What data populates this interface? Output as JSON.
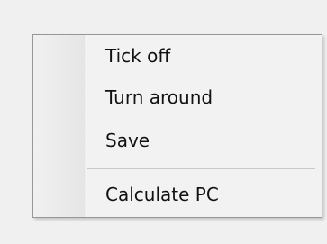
{
  "context_menu": {
    "items": [
      {
        "label": "Tick off"
      },
      {
        "label": "Turn around"
      },
      {
        "label": "Save"
      },
      {
        "label": "Calculate PC"
      }
    ]
  }
}
